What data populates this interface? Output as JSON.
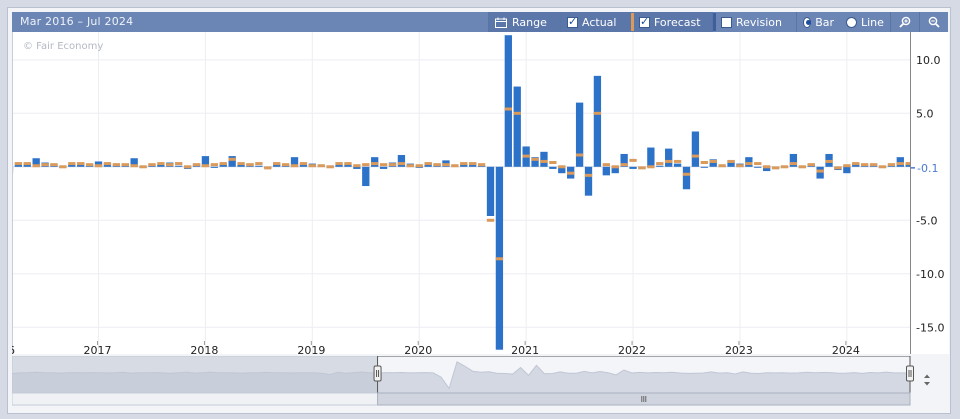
{
  "toolbar": {
    "range_text": "Mar 2016 – Jul 2024",
    "range_label": "Range",
    "actual_label": "Actual",
    "forecast_label": "Forecast",
    "revision_label": "Revision",
    "bar_label": "Bar",
    "line_label": "Line",
    "actual_checked": true,
    "forecast_checked": true,
    "revision_checked": false,
    "mode": "bar",
    "icons": [
      "calendar-icon",
      "zoom-in-icon",
      "zoom-out-icon"
    ]
  },
  "watermark": "© Fair Economy",
  "colors": {
    "actual": "#2c72c9",
    "forecast": "#d99a5b",
    "toolbar": "#6b86b5",
    "latest_marker": "#4a7ad0"
  },
  "chart_data": {
    "type": "bar",
    "ylim": [
      -17.5,
      12.6
    ],
    "yticks": [
      10.0,
      5.0,
      -5.0,
      -10.0,
      -15.0
    ],
    "ytick_labels": [
      "10.0",
      "5.0",
      "-5.0",
      "-10.0",
      "-15.0"
    ],
    "latest_value_label": "-0.1",
    "latest_value": -0.1,
    "xlim": [
      2016.2,
      2024.6
    ],
    "xticks": [
      2017,
      2018,
      2019,
      2020,
      2021,
      2022,
      2023,
      2024
    ],
    "xtick_labels": [
      "2017",
      "2018",
      "2019",
      "2020",
      "2021",
      "2022",
      "2023",
      "2024"
    ],
    "partial_left_label": "6",
    "grid": true,
    "series": [
      {
        "name": "Actual",
        "start": "2016-03",
        "values": [
          -0.6,
          0.2,
          0.3,
          0.8,
          0.4,
          0.3,
          -0.1,
          0.2,
          0.4,
          0.2,
          0.5,
          0.3,
          0.1,
          0.3,
          0.8,
          -0.1,
          0.2,
          0.2,
          0.4,
          0.1,
          -0.2,
          0.3,
          1.0,
          -0.1,
          0.3,
          1.0,
          0.2,
          0.3,
          0.1,
          -0.1,
          0.3,
          0.2,
          0.9,
          0.2,
          0.3,
          0.1,
          0.1,
          0.2,
          0.2,
          -0.2,
          -1.8,
          0.9,
          -0.2,
          0.4,
          1.1,
          0.3,
          -0.1,
          0.4,
          0.3,
          0.6,
          0.1,
          0.3,
          0.4,
          0.1,
          -4.6,
          -17.1,
          12.3,
          7.5,
          1.9,
          0.9,
          1.4,
          -0.2,
          -0.6,
          -1.1,
          6.0,
          -2.7,
          8.5,
          -0.8,
          -0.6,
          1.2,
          -0.2,
          -0.2,
          1.8,
          0.1,
          1.7,
          0.3,
          -2.1,
          3.3,
          0.0,
          0.7,
          0.1,
          0.6,
          0.3,
          0.9,
          0.0,
          -0.4,
          -0.2,
          0.0,
          1.2,
          -0.1,
          0.3,
          -1.1,
          1.2,
          -0.3,
          -0.6,
          0.3,
          0.1,
          0.3,
          -0.1,
          0.1,
          0.9,
          0.3,
          0.6,
          0.5,
          -0.2,
          -0.1,
          0.4,
          -0.5,
          0.6,
          0.1,
          1.0,
          0.1,
          0.1,
          -0.1
        ],
        "color": "#2c72c9"
      },
      {
        "name": "Forecast",
        "start": "2016-03",
        "values": [
          -0.2,
          0.3,
          0.3,
          0.1,
          0.2,
          0.2,
          0.0,
          0.3,
          0.3,
          0.2,
          0.1,
          0.3,
          0.2,
          0.2,
          0.1,
          0.0,
          0.2,
          0.3,
          0.2,
          0.3,
          0.0,
          0.2,
          0.1,
          0.2,
          0.3,
          0.7,
          0.3,
          0.2,
          0.3,
          -0.1,
          0.3,
          0.2,
          0.1,
          0.3,
          0.1,
          0.1,
          0.0,
          0.3,
          0.3,
          0.1,
          0.2,
          0.3,
          0.2,
          0.2,
          0.3,
          0.1,
          0.1,
          0.3,
          0.2,
          0.2,
          0.1,
          0.3,
          0.3,
          0.2,
          -5.0,
          -8.6,
          5.4,
          5.0,
          1.0,
          0.7,
          0.5,
          0.4,
          0.0,
          -0.6,
          1.1,
          -0.8,
          5.0,
          0.2,
          0.0,
          0.2,
          0.6,
          -0.1,
          0.0,
          0.3,
          0.5,
          0.5,
          -0.7,
          1.0,
          0.4,
          0.5,
          0.1,
          0.5,
          0.1,
          0.3,
          0.3,
          0.0,
          -0.1,
          0.0,
          0.3,
          0.0,
          0.2,
          -0.4,
          0.5,
          -0.1,
          0.1,
          0.3,
          0.2,
          0.2,
          0.0,
          0.2,
          0.3,
          0.3,
          0.2,
          0.3,
          0.0,
          0.1,
          0.2,
          0.1,
          0.1,
          0.3,
          0.2,
          0.1,
          0.1,
          0.0
        ],
        "color": "#d99a5b"
      }
    ],
    "navigator": {
      "selection_start": "2020",
      "selection_end": "2024"
    }
  }
}
